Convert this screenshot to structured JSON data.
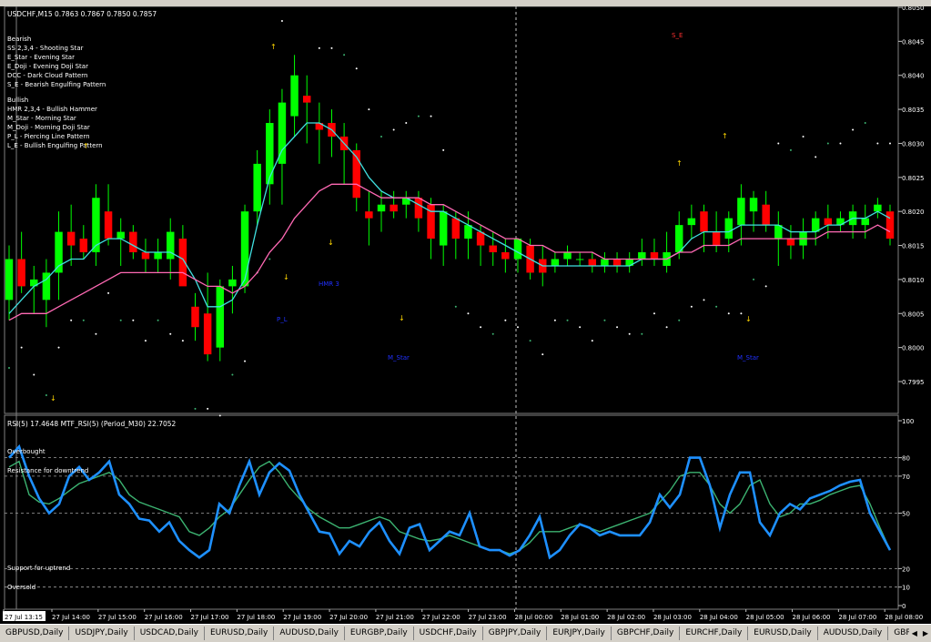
{
  "window": {
    "symbol_title": "USDCHF,M15  0.7863 0.7867 0.7850 0.7857"
  },
  "legend": {
    "bearish_title": "Bearish",
    "bearish": [
      "SS 2,3,4 - Shooting Star",
      "E_Star   - Evening Star",
      "E_Doji   - Evening Doji Star",
      "DCC      - Dark Cloud Pattern",
      "S_E      - Bearish Engulfing Pattern"
    ],
    "bullish_title": "Bullish",
    "bullish": [
      "HMR 2,3,4 - Bullish Hammer",
      "M_Star   - Morning Star",
      "M_Doji   - Morning Doji Star",
      "P_L      - Piercing Line Pattern",
      "L_E      - Bullish Engulfing Pattern"
    ]
  },
  "price_axis": [
    "0.8050",
    "0.8045",
    "0.8040",
    "0.8035",
    "0.8030",
    "0.8025",
    "0.8020",
    "0.8015",
    "0.8010",
    "0.8005",
    "0.8000",
    "0.7995"
  ],
  "pattern_labels": {
    "s_e": "S_E",
    "hmr3": "HMR 3",
    "p_l": "P_L",
    "m_star_1": "M_Star",
    "m_star_2": "M_Star"
  },
  "rsi": {
    "title": "RSI(5) 17.4648  MTF_RSI(5) (Period_M30) 22.7052",
    "levels": {
      "overbought": "Overbought",
      "resistance": "Resistance for downtrend",
      "support": "Support for uptrend",
      "oversold": "Oversold"
    },
    "axis": [
      "100",
      "80",
      "70",
      "50",
      "20",
      "10",
      "0"
    ]
  },
  "time_axis": [
    "27 Jul 13:15",
    "27 Jul 14:00",
    "27 Jul 15:00",
    "27 Jul 16:00",
    "27 Jul 17:00",
    "27 Jul 18:00",
    "27 Jul 19:00",
    "27 Jul 20:00",
    "27 Jul 21:00",
    "27 Jul 22:00",
    "27 Jul 23:00",
    "28 Jul 00:00",
    "28 Jul 01:00",
    "28 Jul 02:00",
    "28 Jul 03:00",
    "28 Jul 04:00",
    "28 Jul 05:00",
    "28 Jul 06:00",
    "28 Jul 07:00",
    "28 Jul 08:00"
  ],
  "tabs": [
    "GBPUSD,Daily",
    "USDJPY,Daily",
    "USDCAD,Daily",
    "EURUSD,Daily",
    "AUDUSD,Daily",
    "EURGBP,Daily",
    "USDCHF,Daily",
    "GBPJPY,Daily",
    "EURJPY,Daily",
    "GBPCHF,Daily",
    "EURCHF,Daily",
    "EURUSD,Daily",
    "AUDUSD,Daily",
    "GBPUSD,Daily"
  ],
  "colors": {
    "bull": "#00ff00",
    "bear": "#ff0000",
    "fast_ma": "#40e0e0",
    "slow_ma": "#ff69b4",
    "rsi": "#1e90ff",
    "mtf_rsi": "#3cb371",
    "sar": "#ffffff"
  },
  "chart_data": [
    {
      "type": "candlestick",
      "title": "USDCHF,M15",
      "ylim": [
        0.7992,
        0.805
      ],
      "candles": [
        [
          0.8007,
          0.8015,
          0.8004,
          0.8013
        ],
        [
          0.8013,
          0.8017,
          0.8008,
          0.8009
        ],
        [
          0.8009,
          0.8012,
          0.8005,
          0.801
        ],
        [
          0.8007,
          0.8013,
          0.8003,
          0.8011
        ],
        [
          0.8011,
          0.802,
          0.8007,
          0.8017
        ],
        [
          0.8017,
          0.8021,
          0.8012,
          0.8015
        ],
        [
          0.8016,
          0.8018,
          0.8013,
          0.8014
        ],
        [
          0.8014,
          0.8024,
          0.8012,
          0.8022
        ],
        [
          0.802,
          0.8024,
          0.8015,
          0.8016
        ],
        [
          0.8016,
          0.8019,
          0.8012,
          0.8017
        ],
        [
          0.8017,
          0.8018,
          0.8013,
          0.8014
        ],
        [
          0.8014,
          0.8016,
          0.8011,
          0.8013
        ],
        [
          0.8013,
          0.8016,
          0.8011,
          0.8014
        ],
        [
          0.8013,
          0.8019,
          0.801,
          0.8017
        ],
        [
          0.8016,
          0.8018,
          0.801,
          0.8009
        ],
        [
          0.8006,
          0.8008,
          0.8001,
          0.8003
        ],
        [
          0.8005,
          0.8011,
          0.7998,
          0.7999
        ],
        [
          0.8,
          0.801,
          0.7998,
          0.8009
        ],
        [
          0.8009,
          0.8012,
          0.8005,
          0.801
        ],
        [
          0.8009,
          0.8021,
          0.8008,
          0.802
        ],
        [
          0.802,
          0.8029,
          0.8018,
          0.8027
        ],
        [
          0.8024,
          0.8035,
          0.8021,
          0.8033
        ],
        [
          0.8027,
          0.8038,
          0.8021,
          0.8036
        ],
        [
          0.8034,
          0.8043,
          0.8031,
          0.804
        ],
        [
          0.8037,
          0.804,
          0.803,
          0.8036
        ],
        [
          0.8033,
          0.8036,
          0.8027,
          0.8032
        ],
        [
          0.8033,
          0.8035,
          0.8028,
          0.8031
        ],
        [
          0.8031,
          0.8033,
          0.8024,
          0.8029
        ],
        [
          0.8029,
          0.803,
          0.802,
          0.8022
        ],
        [
          0.802,
          0.8023,
          0.8015,
          0.8019
        ],
        [
          0.802,
          0.8023,
          0.8017,
          0.8021
        ],
        [
          0.8021,
          0.8023,
          0.8019,
          0.802
        ],
        [
          0.8021,
          0.8023,
          0.8019,
          0.8022
        ],
        [
          0.8022,
          0.8023,
          0.8017,
          0.8019
        ],
        [
          0.8021,
          0.8022,
          0.8013,
          0.8016
        ],
        [
          0.8015,
          0.8021,
          0.8012,
          0.802
        ],
        [
          0.8019,
          0.802,
          0.8013,
          0.8016
        ],
        [
          0.8016,
          0.802,
          0.8013,
          0.8018
        ],
        [
          0.8017,
          0.8018,
          0.8012,
          0.8015
        ],
        [
          0.8015,
          0.8017,
          0.8012,
          0.8014
        ],
        [
          0.8014,
          0.8016,
          0.8011,
          0.8013
        ],
        [
          0.8013,
          0.8015,
          0.8011,
          0.8016
        ],
        [
          0.8015,
          0.8016,
          0.801,
          0.8011
        ],
        [
          0.8013,
          0.8015,
          0.8009,
          0.8011
        ],
        [
          0.8012,
          0.8014,
          0.8011,
          0.8013
        ],
        [
          0.8013,
          0.8015,
          0.8012,
          0.8014
        ],
        [
          0.8013,
          0.8014,
          0.8012,
          0.8013
        ],
        [
          0.8013,
          0.8014,
          0.8011,
          0.8012
        ],
        [
          0.8012,
          0.8014,
          0.8011,
          0.8013
        ],
        [
          0.8013,
          0.8014,
          0.8011,
          0.8012
        ],
        [
          0.8012,
          0.8014,
          0.8011,
          0.8013
        ],
        [
          0.8013,
          0.8016,
          0.8012,
          0.8014
        ],
        [
          0.8014,
          0.8016,
          0.8012,
          0.8013
        ],
        [
          0.8012,
          0.8017,
          0.8011,
          0.8014
        ],
        [
          0.8014,
          0.802,
          0.8013,
          0.8018
        ],
        [
          0.8018,
          0.8021,
          0.8016,
          0.8019
        ],
        [
          0.802,
          0.8021,
          0.8014,
          0.8017
        ],
        [
          0.8017,
          0.802,
          0.8014,
          0.8015
        ],
        [
          0.8016,
          0.802,
          0.8014,
          0.8019
        ],
        [
          0.8018,
          0.8024,
          0.8015,
          0.8022
        ],
        [
          0.802,
          0.8023,
          0.8017,
          0.8022
        ],
        [
          0.8021,
          0.8023,
          0.8017,
          0.8018
        ],
        [
          0.8016,
          0.802,
          0.8012,
          0.8018
        ],
        [
          0.8016,
          0.8018,
          0.8013,
          0.8015
        ],
        [
          0.8015,
          0.8019,
          0.8013,
          0.8017
        ],
        [
          0.8017,
          0.802,
          0.8015,
          0.8019
        ],
        [
          0.8019,
          0.8021,
          0.8016,
          0.8018
        ],
        [
          0.8018,
          0.802,
          0.8017,
          0.8019
        ],
        [
          0.8018,
          0.8021,
          0.8016,
          0.802
        ],
        [
          0.8018,
          0.8021,
          0.8016,
          0.8019
        ],
        [
          0.802,
          0.8022,
          0.8019,
          0.8021
        ],
        [
          0.802,
          0.8021,
          0.8015,
          0.8016
        ]
      ],
      "series": [
        {
          "name": "",
          "values": [
            0.8005,
            0.8007,
            0.8009,
            0.801,
            0.8012,
            0.8013,
            0.8013,
            0.8015,
            0.8016,
            0.8016,
            0.8015,
            0.8014,
            0.8014,
            0.8014,
            0.8013,
            0.801,
            0.8006,
            0.8006,
            0.8007,
            0.801,
            0.8018,
            0.8025,
            0.8029,
            0.8031,
            0.8033,
            0.8033,
            0.8032,
            0.803,
            0.8028,
            0.8025,
            0.8023,
            0.8022,
            0.8022,
            0.8021,
            0.802,
            0.802,
            0.8019,
            0.8018,
            0.8017,
            0.8016,
            0.8015,
            0.8014,
            0.8013,
            0.8012,
            0.8012,
            0.8012,
            0.8012,
            0.8012,
            0.8012,
            0.8012,
            0.8012,
            0.8013,
            0.8013,
            0.8013,
            0.8014,
            0.8016,
            0.8017,
            0.8017,
            0.8017,
            0.8018,
            0.8018,
            0.8018,
            0.8018,
            0.8017,
            0.8017,
            0.8017,
            0.8018,
            0.8018,
            0.8019,
            0.8019,
            0.802,
            0.8019
          ]
        },
        {
          "name": "",
          "values": [
            0.8004,
            0.8005,
            0.8005,
            0.8005,
            0.8006,
            0.8007,
            0.8008,
            0.8009,
            0.801,
            0.8011,
            0.8011,
            0.8011,
            0.8011,
            0.8011,
            0.8011,
            0.801,
            0.8009,
            0.8009,
            0.8008,
            0.8009,
            0.8011,
            0.8014,
            0.8016,
            0.8019,
            0.8021,
            0.8023,
            0.8024,
            0.8024,
            0.8024,
            0.8023,
            0.8022,
            0.8022,
            0.8022,
            0.8022,
            0.8021,
            0.8021,
            0.802,
            0.8019,
            0.8018,
            0.8017,
            0.8016,
            0.8016,
            0.8015,
            0.8015,
            0.8014,
            0.8014,
            0.8014,
            0.8014,
            0.8013,
            0.8013,
            0.8013,
            0.8013,
            0.8013,
            0.8013,
            0.8014,
            0.8014,
            0.8015,
            0.8015,
            0.8015,
            0.8016,
            0.8016,
            0.8016,
            0.8016,
            0.8016,
            0.8016,
            0.8016,
            0.8017,
            0.8017,
            0.8017,
            0.8017,
            0.8018,
            0.8017
          ]
        }
      ]
    },
    {
      "type": "line",
      "title": "RSI(5) 17.4648  MTF_RSI(5) (Period_M30) 22.7052",
      "ylim": [
        0,
        100
      ],
      "series": [
        {
          "name": "RSI(5)",
          "values": [
            80,
            86,
            70,
            58,
            50,
            55,
            70,
            75,
            68,
            72,
            78,
            60,
            55,
            47,
            46,
            40,
            45,
            35,
            30,
            26,
            30,
            55,
            50,
            65,
            78,
            60,
            72,
            77,
            73,
            60,
            50,
            40,
            39,
            28,
            35,
            32,
            40,
            45,
            35,
            28,
            42,
            44,
            30,
            35,
            40,
            38,
            50,
            32,
            30,
            30,
            27,
            30,
            38,
            48,
            26,
            30,
            38,
            44,
            42,
            38,
            40,
            38,
            38,
            38,
            45,
            60,
            53,
            60,
            80,
            80,
            65,
            42,
            60,
            72,
            72,
            45,
            38,
            50,
            55,
            52,
            58,
            60,
            62,
            65,
            67,
            68,
            50,
            40,
            30
          ]
        },
        {
          "name": "MTF_RSI(5)",
          "values": [
            75,
            78,
            60,
            56,
            55,
            58,
            62,
            66,
            68,
            70,
            72,
            68,
            60,
            56,
            54,
            52,
            50,
            48,
            40,
            38,
            42,
            48,
            52,
            60,
            68,
            75,
            78,
            72,
            64,
            58,
            52,
            48,
            45,
            42,
            42,
            44,
            46,
            48,
            46,
            40,
            38,
            36,
            35,
            36,
            38,
            36,
            34,
            32,
            30,
            30,
            28,
            30,
            34,
            40,
            40,
            40,
            42,
            44,
            42,
            40,
            42,
            44,
            46,
            48,
            50,
            56,
            62,
            70,
            72,
            72,
            65,
            55,
            50,
            55,
            65,
            68,
            55,
            48,
            50,
            55,
            55,
            57,
            60,
            62,
            64,
            65,
            55,
            42,
            30
          ]
        }
      ]
    }
  ]
}
